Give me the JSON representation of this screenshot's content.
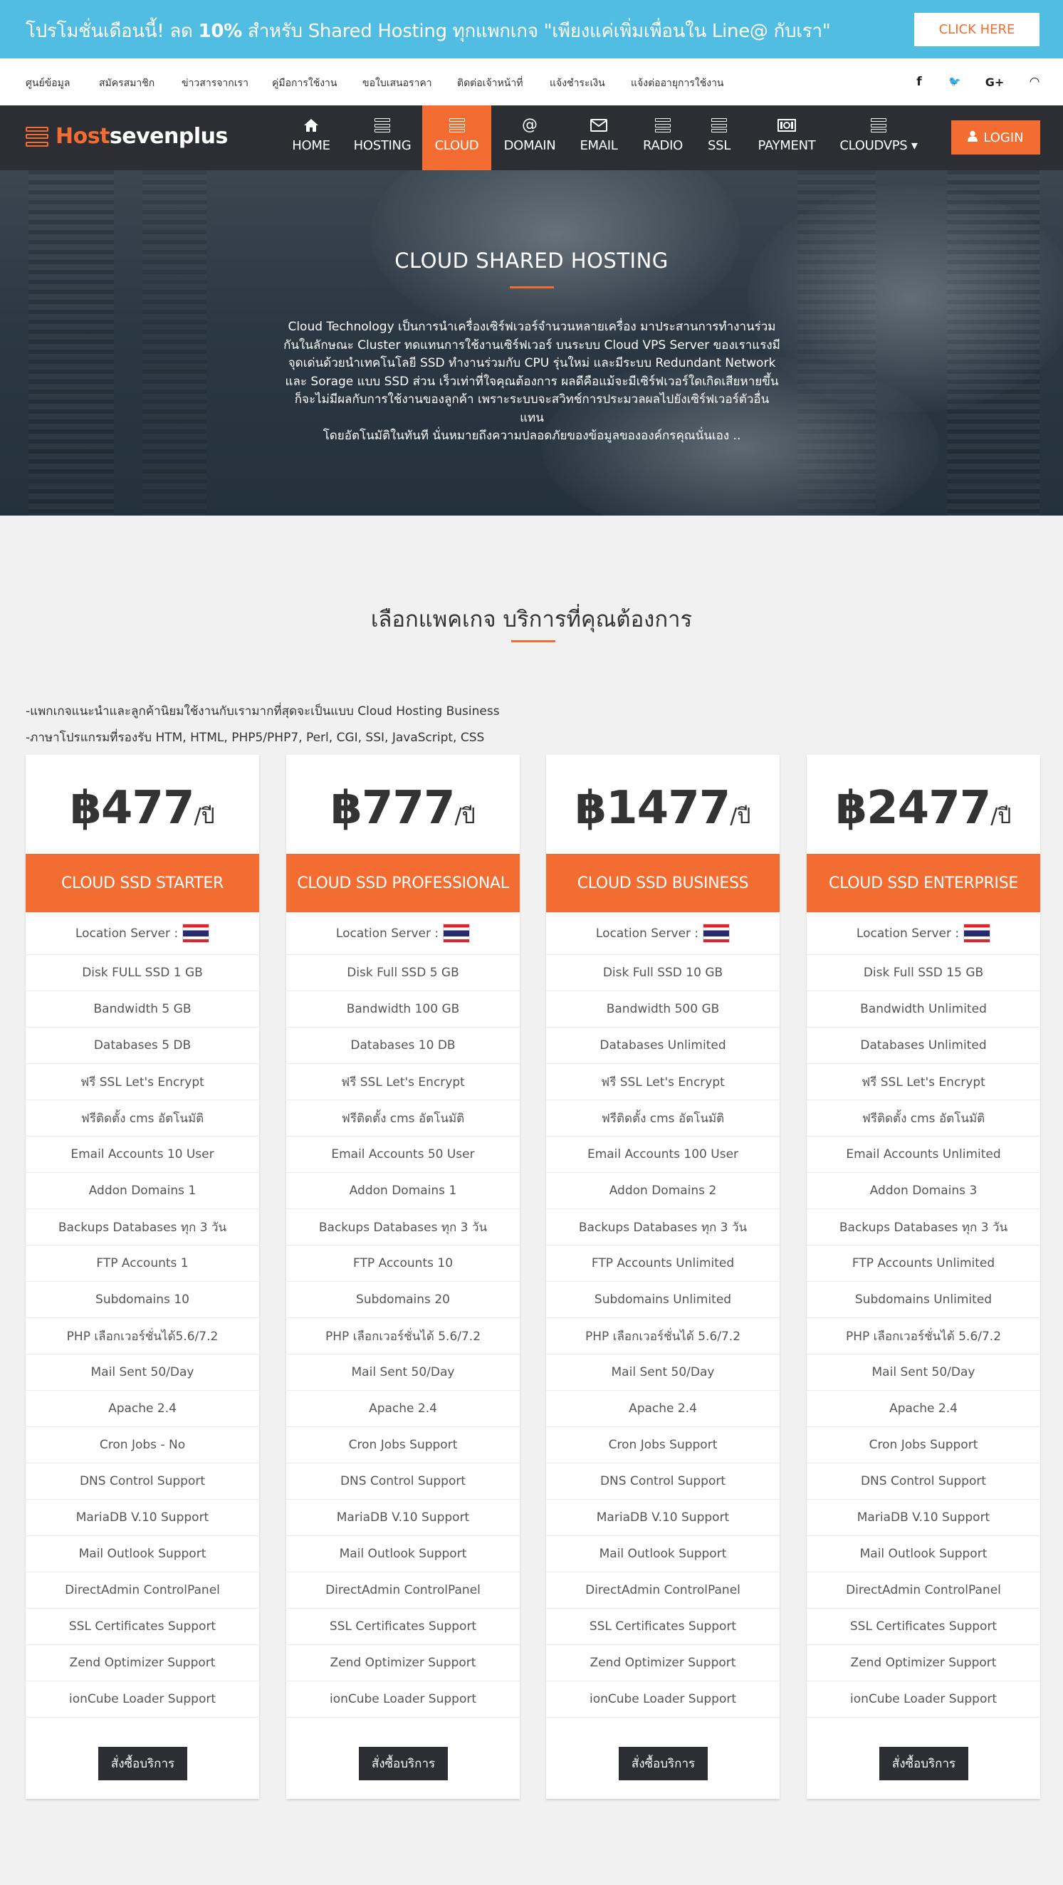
{
  "promo": {
    "text_prefix": "โปรโมชั่นเดือนนี้! ลด ",
    "text_bold": "10%",
    "text_suffix": " สำหรับ Shared Hosting ทุกแพกเกจ \"เพียงแค่เพิ่มเพื่อนใน Line@ กับเรา\"",
    "button": "CLICK HERE"
  },
  "toplinks": [
    "ศูนย์ข้อมูล",
    "สมัครสมาชิก",
    "ข่าวสารจากเรา",
    "คู่มือการใช้งาน",
    "ขอใบเสนอราคา",
    "ติดต่อเจ้าหน้าที่",
    "แจ้งชำระเงิน",
    "แจ้งต่ออายุการใช้งาน"
  ],
  "social": [
    {
      "icon": "facebook-icon",
      "glyph": "f"
    },
    {
      "icon": "twitter-icon",
      "glyph": "🐦"
    },
    {
      "icon": "google-plus-icon",
      "glyph": "G+"
    },
    {
      "icon": "rss-icon",
      "glyph": "◠"
    }
  ],
  "brand": {
    "accent": "Host",
    "rest": "sevenplus"
  },
  "nav": [
    {
      "label": "HOME",
      "icon": "home-icon"
    },
    {
      "label": "HOSTING",
      "icon": "server-icon"
    },
    {
      "label": "CLOUD",
      "icon": "server-icon",
      "active": true
    },
    {
      "label": "DOMAIN",
      "icon": "at-icon"
    },
    {
      "label": "EMAIL",
      "icon": "envelope-icon"
    },
    {
      "label": "RADIO",
      "icon": "server-icon"
    },
    {
      "label": "SSL",
      "icon": "server-icon"
    },
    {
      "label": "PAYMENT",
      "icon": "money-icon"
    },
    {
      "label": "CLOUDVPS ▾",
      "icon": "server-icon"
    }
  ],
  "login": "LOGIN",
  "hero": {
    "title": "CLOUD SHARED HOSTING",
    "desc": [
      "Cloud Technology เป็นการนำเครื่องเซิร์ฟเวอร์จำนวนหลายเครื่อง มาประสานการทำงานร่วม",
      "กันในลักษณะ Cluster ทดแทนการใช้งานเซิร์ฟเวอร์ บนระบบ Cloud VPS Server ของเราแรงมี",
      "จุดเด่นด้วยนำเทคโนโลยี SSD ทำงานร่วมกับ CPU รุ่นใหม่ และมีระบบ Redundant Network",
      "และ Sorage แบบ SSD ส่วน เร็วเท่าที่ใจคุณต้องการ ผลดีคือแม้จะมีเซิร์ฟเวอร์ใดเกิดเสียหายขึ้น",
      "ก็จะไม่มีผลกับการใช้งานของลูกค้า เพราะระบบจะสวิทช์การประมวลผลไปยังเซิร์ฟเวอร์ตัวอื่น แทน",
      "โดยอัตโนมัติในทันที นั่นหมายถึงความปลอดภัยของข้อมูลขององค์กรคุณนั่นเอง .."
    ]
  },
  "section": {
    "title": "เลือกแพคเกจ บริการที่คุณต้องการ",
    "notes": [
      "-แพกเกจแนะนำและลูกค้านิยมใช้งานกับเรามากที่สุดจะเป็นแบบ Cloud Hosting Business",
      "-ภาษาโปรแกรมที่รองรับ HTM, HTML, PHP5/PHP7, Perl, CGI, SSI, JavaScript, CSS"
    ]
  },
  "plans": [
    {
      "price": "฿477",
      "per": "/ปี",
      "name": "CLOUD SSD STARTER",
      "location_label": "Location Server :",
      "features": [
        "Disk FULL SSD 1 GB",
        "Bandwidth 5 GB",
        "Databases 5 DB",
        "ฟรี SSL Let's Encrypt",
        "ฟรีติดตั้ง cms อัตโนมัติ",
        "Email Accounts 10 User",
        "Addon Domains 1",
        "Backups Databases ทุก 3 วัน",
        "FTP Accounts 1",
        "Subdomains 10",
        "PHP เลือกเวอร์ชั่นได้5.6/7.2",
        "Mail Sent 50/Day",
        "Apache 2.4",
        "Cron Jobs - No",
        "DNS Control Support",
        "MariaDB V.10 Support",
        "Mail Outlook Support",
        "DirectAdmin ControlPanel",
        "SSL Certificates Support",
        "Zend Optimizer Support",
        "ionCube Loader Support"
      ],
      "order": "สั่งซื้อบริการ"
    },
    {
      "price": "฿777",
      "per": "/ปี",
      "name": "CLOUD SSD PROFESSIONAL",
      "location_label": "Location Server :",
      "features": [
        "Disk Full SSD 5 GB",
        "Bandwidth 100 GB",
        "Databases 10 DB",
        "ฟรี SSL Let's Encrypt",
        "ฟรีติดตั้ง cms อัตโนมัติ",
        "Email Accounts 50 User",
        "Addon Domains 1",
        "Backups Databases ทุก 3 วัน",
        "FTP Accounts 10",
        "Subdomains 20",
        "PHP เลือกเวอร์ชั่นได้ 5.6/7.2",
        "Mail Sent 50/Day",
        "Apache 2.4",
        "Cron Jobs Support",
        "DNS Control Support",
        "MariaDB V.10 Support",
        "Mail Outlook Support",
        "DirectAdmin ControlPanel",
        "SSL Certificates Support",
        "Zend Optimizer Support",
        "ionCube Loader Support"
      ],
      "order": "สั่งซื้อบริการ"
    },
    {
      "price": "฿1477",
      "per": "/ปี",
      "name": "CLOUD SSD BUSINESS",
      "location_label": "Location Server :",
      "features": [
        "Disk Full SSD 10 GB",
        "Bandwidth 500 GB",
        "Databases Unlimited",
        "ฟรี SSL Let's Encrypt",
        "ฟรีติดตั้ง cms อัตโนมัติ",
        "Email Accounts 100 User",
        "Addon Domains 2",
        "Backups Databases ทุก 3 วัน",
        "FTP Accounts Unlimited",
        "Subdomains Unlimited",
        "PHP เลือกเวอร์ชั่นได้ 5.6/7.2",
        "Mail Sent 50/Day",
        "Apache 2.4",
        "Cron Jobs Support",
        "DNS Control Support",
        "MariaDB V.10 Support",
        "Mail Outlook Support",
        "DirectAdmin ControlPanel",
        "SSL Certificates Support",
        "Zend Optimizer Support",
        "ionCube Loader Support"
      ],
      "order": "สั่งซื้อบริการ"
    },
    {
      "price": "฿2477",
      "per": "/ปี",
      "name": "CLOUD SSD ENTERPRISE",
      "location_label": "Location Server :",
      "features": [
        "Disk Full SSD 15 GB",
        "Bandwidth Unlimited",
        "Databases Unlimited",
        "ฟรี SSL Let's Encrypt",
        "ฟรีติดตั้ง cms อัตโนมัติ",
        "Email Accounts Unlimited",
        "Addon Domains 3",
        "Backups Databases ทุก 3 วัน",
        "FTP Accounts Unlimited",
        "Subdomains Unlimited",
        "PHP เลือกเวอร์ชั่นได้ 5.6/7.2",
        "Mail Sent 50/Day",
        "Apache 2.4",
        "Cron Jobs Support",
        "DNS Control Support",
        "MariaDB V.10 Support",
        "Mail Outlook Support",
        "DirectAdmin ControlPanel",
        "SSL Certificates Support",
        "Zend Optimizer Support",
        "ionCube Loader Support"
      ],
      "order": "สั่งซื้อบริการ"
    }
  ],
  "colors": {
    "accent": "#f36c31",
    "promo_bg": "#52bde3",
    "nav_bg": "#2d2e33",
    "page_bg": "#f1f1f1"
  }
}
